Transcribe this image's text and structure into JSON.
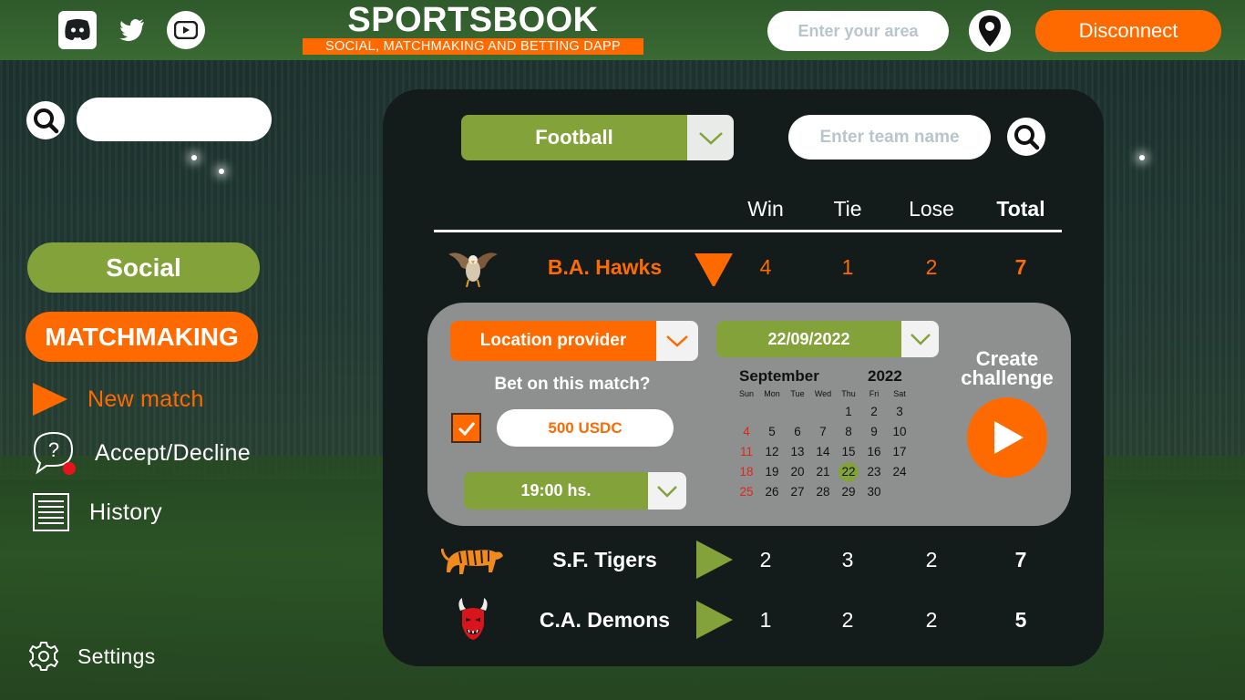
{
  "header": {
    "brand_title": "SPORTSBOOK",
    "brand_subtitle": "SOCIAL, MATCHMAKING AND BETTING DAPP",
    "area_placeholder": "Enter your area",
    "disconnect_label": "Disconnect",
    "social_icons": [
      "discord-icon",
      "twitter-icon",
      "youtube-icon"
    ],
    "location_icon": "map-pin-icon"
  },
  "sidebar": {
    "search_icon": "search-icon",
    "social_label": "Social",
    "matchmaking_label": "MATCHMAKING",
    "items": [
      {
        "label": "New match",
        "icon": "play-triangle-icon"
      },
      {
        "label": "Accept/Decline",
        "icon": "question-bubble-icon"
      },
      {
        "label": "History",
        "icon": "list-document-icon"
      }
    ],
    "settings_label": "Settings"
  },
  "main": {
    "sport_selected": "Football",
    "team_placeholder": "Enter team name",
    "columns": [
      "Win",
      "Tie",
      "Lose",
      "Total"
    ],
    "teams": [
      {
        "name": "B.A. Hawks",
        "win": "4",
        "tie": "1",
        "lose": "2",
        "total": "7",
        "logo": "hawk-logo",
        "expanded": true
      },
      {
        "name": "S.F. Tigers",
        "win": "2",
        "tie": "3",
        "lose": "2",
        "total": "7",
        "logo": "tiger-logo",
        "expanded": false
      },
      {
        "name": "C.A. Demons",
        "win": "1",
        "tie": "2",
        "lose": "2",
        "total": "5",
        "logo": "demon-logo",
        "expanded": false
      }
    ],
    "match": {
      "location_label": "Location provider",
      "bet_question": "Bet on this match?",
      "bet_checked": true,
      "bet_amount": "500 USDC",
      "time": "19:00 hs.",
      "date": "22/09/2022",
      "create_label": "Create challenge",
      "calendar": {
        "month": "September",
        "year": "2022",
        "days_of_week": [
          "Sun",
          "Mon",
          "Tue",
          "Wed",
          "Thu",
          "Fri",
          "Sat"
        ],
        "weeks": [
          [
            "",
            "",
            "",
            "",
            "1",
            "2",
            "3"
          ],
          [
            "4",
            "5",
            "6",
            "7",
            "8",
            "9",
            "10"
          ],
          [
            "11",
            "12",
            "13",
            "14",
            "15",
            "16",
            "17"
          ],
          [
            "18",
            "19",
            "20",
            "21",
            "22",
            "23",
            "24"
          ],
          [
            "25",
            "26",
            "27",
            "28",
            "29",
            "30",
            ""
          ]
        ],
        "selected_day": "22"
      }
    }
  },
  "colors": {
    "orange": "#ff6a00",
    "green": "#84a23a",
    "panel": "#131c1b"
  }
}
